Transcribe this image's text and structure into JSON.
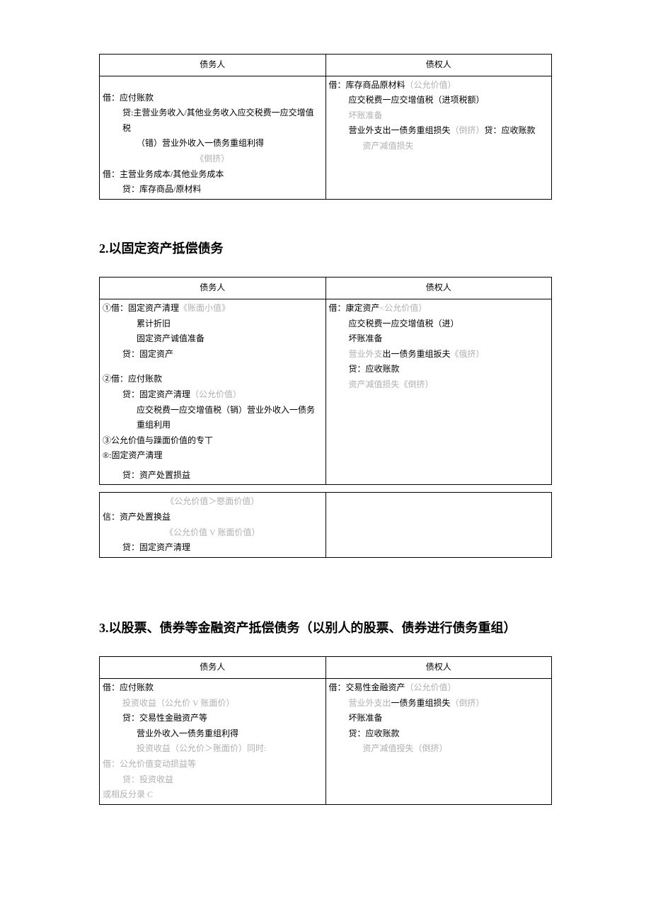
{
  "table1": {
    "header_left": "债务人",
    "header_right": "债权人",
    "left": {
      "l1": "借：应付账款",
      "l2": "贷:主营业务收入/其他业务收入应交税费一应交增值税",
      "l3": "（错）营业外收入一债务重组利得",
      "l4": "《倒挤）",
      "l5": "借：主营业务成本/其他业务成本",
      "l6": "贷：库存商品/原材料"
    },
    "right": {
      "r1": "借：库存商品原材料",
      "r1m": "（公允价值）",
      "r2": "应交税费一应交增值税（进项税额）",
      "r3": "坏账准备",
      "r4a": "营业外支出一债务重组损失",
      "r4m": "（倒挤）",
      "r4b": "贷：应收账款",
      "r5": "资产减值损失"
    }
  },
  "heading2": "2.以固定资产抵偿债务",
  "table2": {
    "header_left": "债务人",
    "header_right": "债权人",
    "left": {
      "l1a": "①借：固定资产清理",
      "l1m": "《账面小值》",
      "l2": "累计折旧",
      "l3": "固定资产诚值准备",
      "l4": "贷：固定资产",
      "l5": "②借：应付账款",
      "l6a": "贷：固定资产清理",
      "l6m": "（公允价值）",
      "l7": "应交税费一应交增值税（销）营业外收入一债务重组利用",
      "l8": "③公允价值与躁面价值的专丅",
      "l9": "®:固定资产清理",
      "l10": "贷：资产处置损益"
    },
    "right": {
      "r1a": "借：康定资产",
      "r1m": "<公允价值）",
      "r2": "应交税费一应交增值税（进）",
      "r3": "坏账准备",
      "r4a": "营业外支",
      "r4b": "出一债务重组扳夫",
      "r4m": "《俄挤）",
      "r5": "贷：应收账款",
      "r6": "资产减值损失《倒挤）"
    }
  },
  "table2b": {
    "left": {
      "l1": "《公允价值＞愍面价值）",
      "l2": "信：资产处置换益",
      "l3": "《公允价值 V 账面价值）",
      "l4": "贷：固定资产清理"
    }
  },
  "heading3": "3.以股票、债券等金融资产抵偿债务（以别人的股票、债券进行债务重组）",
  "table3": {
    "header_left": "债务人",
    "header_right": "债权人",
    "left": {
      "l1": "借：应付账款",
      "l2": "投资收益（公允价 V 账面价）",
      "l3": "贷：交易性金融资产等",
      "l4": "营业外收入一债务重组利得",
      "l5": "投资收益（公允价＞账面价）同时:",
      "l6": "借：公允价值变动损益等",
      "l7": "贷：投资收益",
      "l8": "或相反分录 C"
    },
    "right": {
      "r1a": "借：交易性金融资产",
      "r1m": "（公允价值）",
      "r2a": "营业外支出",
      "r2b": "一债务重组损失",
      "r2m": "（倒挤）",
      "r3": "坏账准备",
      "r4": "贷：应收账款",
      "r5": "资产减值授失（倒挤）"
    }
  }
}
